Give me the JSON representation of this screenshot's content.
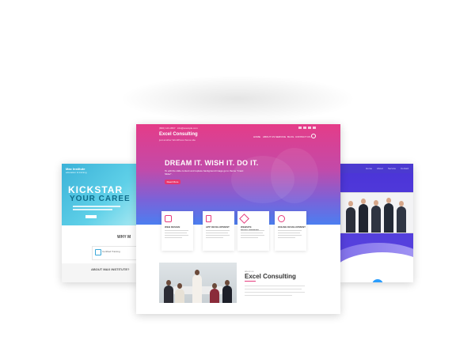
{
  "left_site": {
    "brand": "Max Institute",
    "brand_sub": "education & training",
    "headline_1": "KICKSTAR",
    "headline_2": "YOUR CAREE",
    "section_title": "WHY M",
    "feature_label": "Certified Training",
    "about_label": "ABOUT MAX INSTITUTE?"
  },
  "main_site": {
    "phone": "(800) 123-4567",
    "email": "info@example.com",
    "brand": "Excel Consulting",
    "tagline": "just another WordPress theme site",
    "menu": [
      "HOME",
      "ABOUT US",
      "SERVICE",
      "BLOG",
      "CONTACT US"
    ],
    "headline": "DREAM IT. WISH IT. DO IT.",
    "description": "To edit the slide content and replace background image go to theme \"Imaxi Slider\".",
    "cta_label": "Read More",
    "services": [
      {
        "title": "WEB DESIGN"
      },
      {
        "title": "APP DEVELOPMENT"
      },
      {
        "title": "WEBSITE DEVELOPMENT"
      },
      {
        "title": "ONLINE DEVELOPMENT"
      }
    ],
    "about_small": "about us",
    "about_title": "Excel Consulting"
  },
  "right_site": {
    "menu": [
      "Home",
      "About",
      "Service",
      "Contact"
    ]
  },
  "colors": {
    "main_pink": "#e53c88",
    "main_blue": "#4c7ef0",
    "left_teal": "#3bb2d8",
    "right_purple": "#4c35d8"
  }
}
